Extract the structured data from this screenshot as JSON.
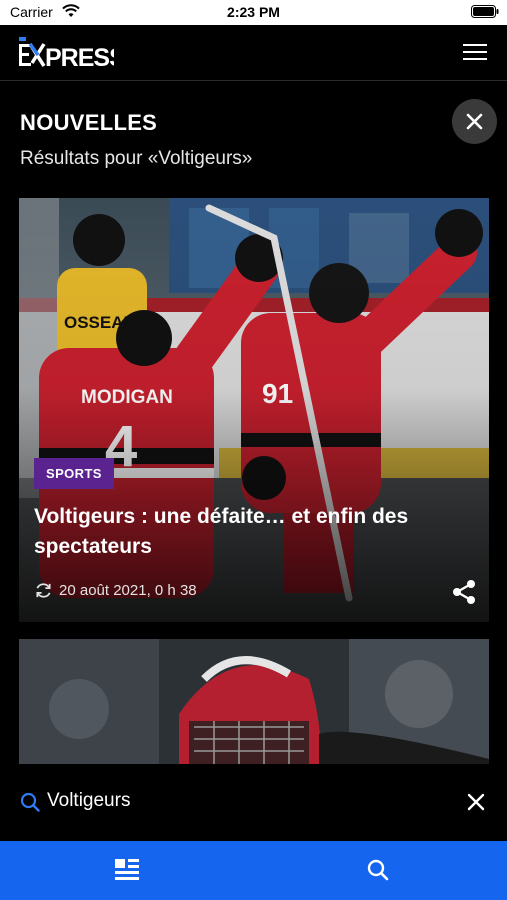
{
  "status_bar": {
    "carrier": "Carrier",
    "time": "2:23 PM"
  },
  "header": {
    "logo_text": "EXPRESS",
    "menu_icon": "hamburger-menu-icon"
  },
  "page": {
    "section_title": "NOUVELLES",
    "results_text": "Résultats pour «Voltigeurs»",
    "close_icon": "close-icon"
  },
  "articles": [
    {
      "category": "SPORTS",
      "title": "Voltigeurs : une défaite… et enfin des spectateurs",
      "date": "20 août 2021, 0 h 38",
      "photo_jerseys": {
        "left": "OSSEAU",
        "back": "MODIGAN",
        "back_number": "4",
        "front_number": "91"
      }
    }
  ],
  "search": {
    "value": "Voltigeurs",
    "placeholder": ""
  },
  "tab_bar": {
    "tabs": [
      {
        "icon": "news-feed-icon"
      },
      {
        "icon": "search-icon"
      }
    ]
  },
  "colors": {
    "accent_blue": "#1565ef",
    "badge_purple": "#5b2390",
    "search_icon_blue": "#2f7cf6"
  }
}
